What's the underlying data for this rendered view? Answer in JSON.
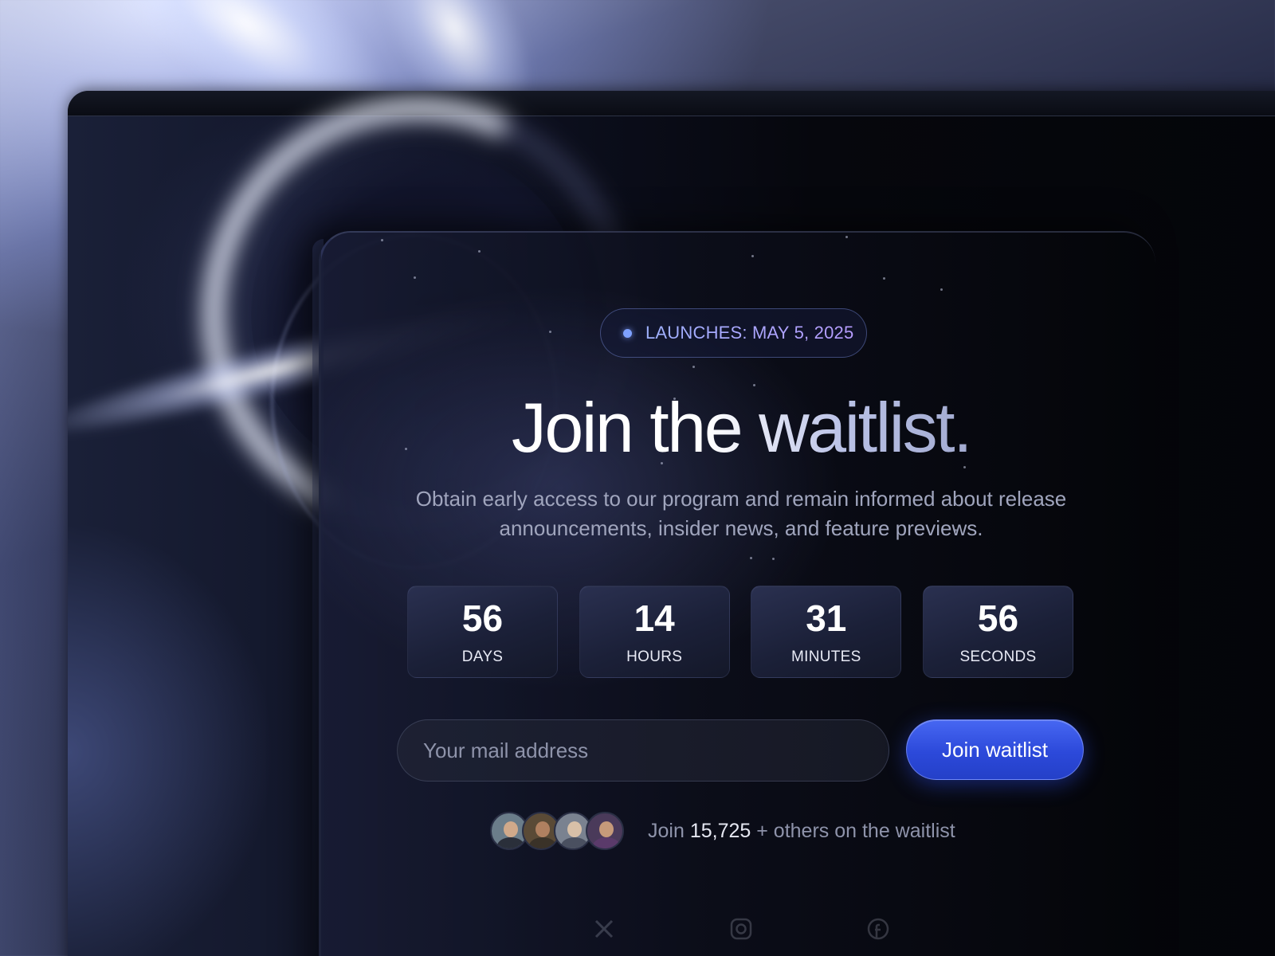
{
  "badge": {
    "text": "LAUNCHES: MAY 5, 2025"
  },
  "headline": "Join the waitlist.",
  "subtitle": "Obtain early access to our program and remain informed about release announcements, insider news, and feature previews.",
  "countdown": [
    {
      "value": "56",
      "label": "DAYS"
    },
    {
      "value": "14",
      "label": "HOURS"
    },
    {
      "value": "31",
      "label": "MINUTES"
    },
    {
      "value": "56",
      "label": "SECONDS"
    }
  ],
  "form": {
    "email_placeholder": "Your mail address",
    "email_value": "",
    "submit_label": "Join waitlist"
  },
  "social_proof": {
    "prefix": "Join",
    "count": "15,725",
    "suffix": "+ others on the waitlist"
  },
  "social_icons": [
    "x-icon",
    "instagram-icon",
    "facebook-icon"
  ],
  "colors": {
    "accent": "#2c49da",
    "badge_dot": "#7ea1ff",
    "badge_gradient_start": "#9fb2ff",
    "badge_gradient_end": "#b79cff"
  }
}
